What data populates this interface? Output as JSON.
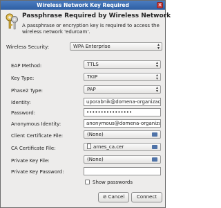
{
  "window": {
    "title": "Wireless Network Key Required",
    "close_glyph": "×"
  },
  "header": {
    "heading": "Passphrase Required by Wireless Network",
    "description": "A passphrase or encryption key is required to access the wireless network 'eduroam'."
  },
  "security": {
    "label": "Wireless Security:",
    "value": "WPA Enterprise"
  },
  "fields": {
    "eap_method": {
      "label": "EAP Method:",
      "value": "TTLS"
    },
    "key_type": {
      "label": "Key Type:",
      "value": "TKIP"
    },
    "phase2_type": {
      "label": "Phase2 Type:",
      "value": "PAP"
    },
    "identity": {
      "label": "Identity:",
      "value": "uporabnik@domena-organizacije"
    },
    "password": {
      "label": "Password:",
      "value": "••••••••••••••••"
    },
    "anonymous_identity": {
      "label": "Anonymous Identity:",
      "value": "anonymous@domena-organizacije"
    },
    "client_cert": {
      "label": "Client Certificate File:",
      "value": "(None)"
    },
    "ca_cert": {
      "label": "CA Certificate File:",
      "value": "arnes_ca.cer"
    },
    "private_key": {
      "label": "Private Key File:",
      "value": "(None)"
    },
    "private_key_password": {
      "label": "Private Key Password:",
      "value": ""
    }
  },
  "show_passwords": {
    "label": "Show passwords",
    "checked": false
  },
  "buttons": {
    "cancel": {
      "label": "Cancel",
      "icon": "cancel-icon"
    },
    "connect": {
      "label": "Connect"
    }
  }
}
